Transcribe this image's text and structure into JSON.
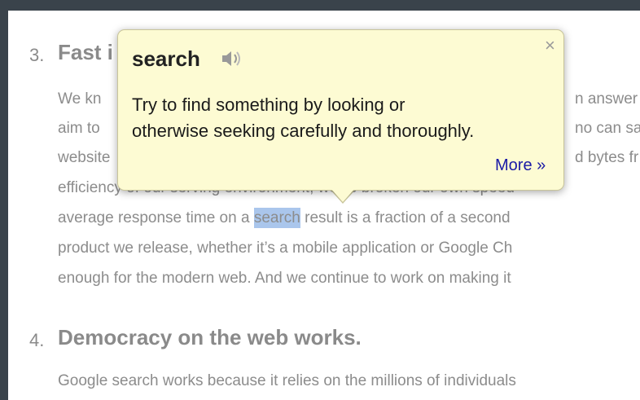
{
  "items": [
    {
      "number": "3.",
      "title": "Fast i",
      "lines": [
        "We kn",
        "aim to",
        "website",
        "efficiency of our serving environment, we've broken our own speed",
        "average response time on a ",
        "product we release, whether it’s a mobile application or Google Ch",
        "enough for the modern web. And we continue to work on making it"
      ],
      "right_fragments": [
        "n answer",
        "no can sa",
        "d bytes fr"
      ],
      "highlighted_word": "search",
      "line5_tail": " result is a fraction of a second"
    },
    {
      "number": "4.",
      "title": "Democracy on the web works.",
      "lines": [
        "Google search works because it relies on the millions of individuals"
      ]
    }
  ],
  "popup": {
    "word": "search",
    "definition_line1": "Try to find something by looking or",
    "definition_line2": "otherwise seeking carefully and thoroughly.",
    "more_label": "More »",
    "close_label": "×",
    "speaker_icon": "speaker-icon",
    "close_icon": "close-icon"
  }
}
